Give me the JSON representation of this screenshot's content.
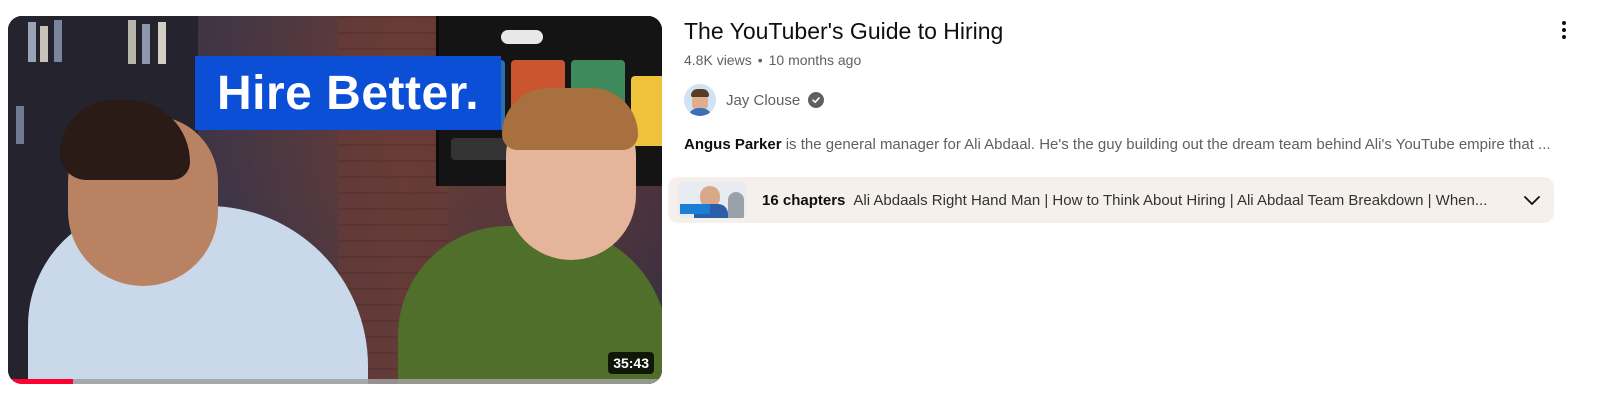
{
  "video": {
    "thumbnail_banner_text": "Hire Better.",
    "duration": "35:43",
    "watch_progress": 0.1,
    "title": "The YouTuber's Guide to Hiring",
    "views": "4.8K views",
    "separator": "•",
    "age": "10 months ago",
    "channel": {
      "name": "Jay Clouse",
      "verified": true
    },
    "description": {
      "lead": "Angus Parker",
      "rest": " is the general manager for Ali Abdaal. He's the guy building out the dream team behind Ali's YouTube empire that ..."
    },
    "chapters": {
      "count_label": "16 chapters",
      "titles": "Ali Abdaals Right Hand Man | How to Think About Hiring | Ali Abdaal Team Breakdown | When..."
    }
  },
  "icons": {
    "more": "vertical-dots-icon",
    "verified": "checkmark-badge-icon",
    "expand": "chevron-down-icon"
  },
  "colors": {
    "progress": "#ff0033",
    "banner": "#0a4fd6",
    "chapters_bg": "#f5f0ec",
    "secondary_text": "#606060"
  }
}
